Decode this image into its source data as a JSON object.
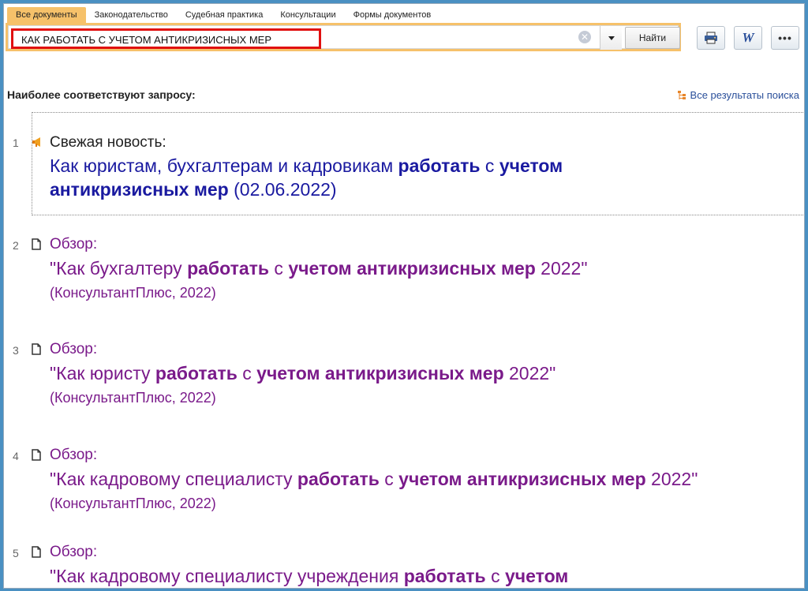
{
  "tabs": [
    "Все документы",
    "Законодательство",
    "Судебная практика",
    "Консультации",
    "Формы документов"
  ],
  "search": {
    "value": "КАК РАБОТАТЬ С УЧЕТОМ АНТИКРИЗИСНЫХ МЕР",
    "button": "Найти"
  },
  "toolbar": {
    "print_icon": "printer-icon",
    "word_icon": "word-icon",
    "word_glyph": "W",
    "more_glyph": "•••"
  },
  "section_title": "Наиболее соответствуют запросу:",
  "all_results": "Все результаты поиска",
  "results": [
    {
      "num": "1",
      "label": "Свежая новость:",
      "line1_a": "Как юристам, бухгалтерам и кадровикам ",
      "line1_b": "работать",
      "line1_c": " с ",
      "line1_d": "учетом",
      "line2_a": "антикризисных мер",
      "line2_b": " (02.06.2022)"
    },
    {
      "num": "2",
      "label": "Обзор:",
      "t_a": "\"Как бухгалтеру ",
      "t_b": "работать",
      "t_c": " с ",
      "t_d": "учетом антикризисных мер",
      "t_e": " 2022\"",
      "src": "(КонсультантПлюс, 2022)"
    },
    {
      "num": "3",
      "label": "Обзор:",
      "t_a": "\"Как юристу ",
      "t_b": "работать",
      "t_c": " с ",
      "t_d": "учетом антикризисных мер",
      "t_e": " 2022\"",
      "src": "(КонсультантПлюс, 2022)"
    },
    {
      "num": "4",
      "label": "Обзор:",
      "t_a": "\"Как кадровому специалисту ",
      "t_b": "работать",
      "t_c": " с ",
      "t_d": "учетом антикризисных мер",
      "t_e": " 2022\"",
      "src": "(КонсультантПлюс, 2022)"
    },
    {
      "num": "5",
      "label": "Обзор:",
      "t_a": "\"Как кадровому специалисту учреждения ",
      "t_b": "работать",
      "t_c": " с ",
      "t_d": "учетом"
    }
  ],
  "colors": {
    "accent": "#f6c16a",
    "news_text": "#1a1aa0",
    "review_text": "#7a1a8a",
    "highlight_box": "#e01010"
  }
}
